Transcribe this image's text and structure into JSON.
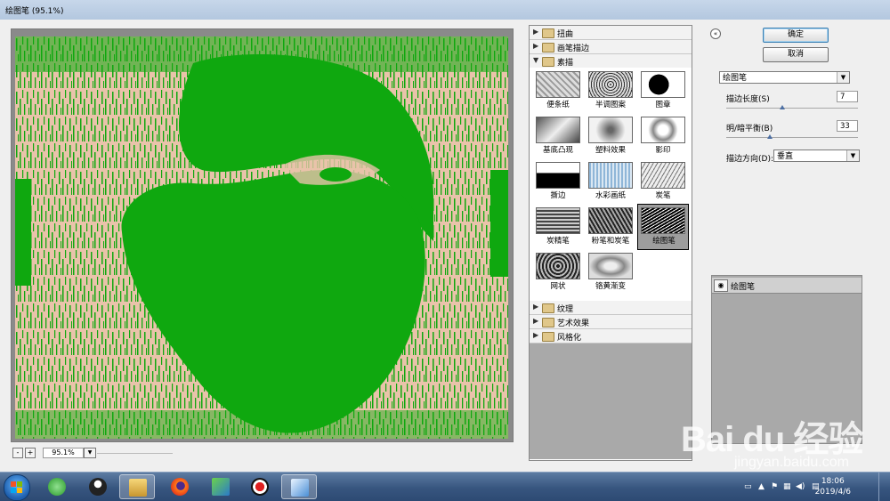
{
  "window": {
    "title": "绘图笔 (95.1%)"
  },
  "preview": {
    "zoom_minus": "-",
    "zoom_plus": "+",
    "zoom_value": "95.1%"
  },
  "filters": {
    "categories_top": [
      {
        "label": "扭曲",
        "expanded": false
      },
      {
        "label": "画笔描边",
        "expanded": false
      },
      {
        "label": "素描",
        "expanded": true
      }
    ],
    "thumbnails": [
      {
        "label": "便条纸"
      },
      {
        "label": "半调图案"
      },
      {
        "label": "图章"
      },
      {
        "label": "基底凸现"
      },
      {
        "label": "塑料效果"
      },
      {
        "label": "影印"
      },
      {
        "label": "撕边"
      },
      {
        "label": "水彩画纸"
      },
      {
        "label": "炭笔"
      },
      {
        "label": "炭精笔"
      },
      {
        "label": "粉笔和炭笔"
      },
      {
        "label": "绘图笔",
        "selected": true
      },
      {
        "label": "网状"
      },
      {
        "label": "铬黄渐变"
      }
    ],
    "categories_bottom": [
      {
        "label": "纹理",
        "expanded": false
      },
      {
        "label": "艺术效果",
        "expanded": false
      },
      {
        "label": "风格化",
        "expanded": false
      }
    ]
  },
  "buttons": {
    "ok": "确定",
    "cancel": "取消",
    "collapse": "«"
  },
  "settings": {
    "filter_select": "绘图笔",
    "stroke_length_label": "描边长度(S)",
    "stroke_length_value": "7",
    "light_dark_label": "明/暗平衡(B)",
    "light_dark_value": "33",
    "direction_label": "描边方向(D):",
    "direction_value": "垂直"
  },
  "layers": {
    "items": [
      {
        "label": "绘图笔"
      }
    ]
  },
  "watermark": {
    "main": "Bai du 经验",
    "sub": "jingyan.baidu.com"
  },
  "taskbar": {
    "time": "18:06",
    "date": "2019/4/6"
  },
  "colors": {
    "preview_green": "#0fa80f",
    "preview_peach": "#e9c3aa",
    "accent": "#3c7fb1"
  }
}
